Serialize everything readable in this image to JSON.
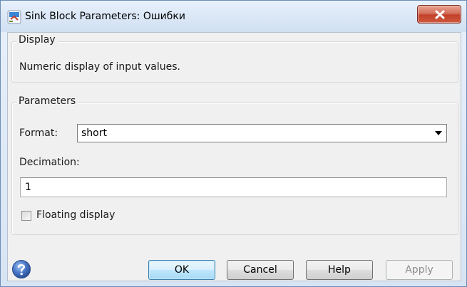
{
  "window": {
    "title": "Sink Block Parameters: Ошибки",
    "close_glyph": "x"
  },
  "display_group": {
    "legend": "Display",
    "description": "Numeric display of input values."
  },
  "parameters_group": {
    "legend": "Parameters",
    "format_label": "Format:",
    "format_value": "short",
    "decimation_label": "Decimation:",
    "decimation_value": "1",
    "floating_display_label": "Floating display",
    "floating_display_checked": false
  },
  "buttons": {
    "ok": "OK",
    "cancel": "Cancel",
    "help": "Help",
    "apply": "Apply"
  },
  "icons": {
    "title_icon": "simulink-block-icon",
    "help_icon": "help-question-icon",
    "dropdown_icon": "chevron-down-icon",
    "close_icon": "close-icon"
  },
  "colors": {
    "close_button": "#c2402a",
    "default_button_border": "#3c7fb1",
    "help_icon": "#3d66b2"
  }
}
